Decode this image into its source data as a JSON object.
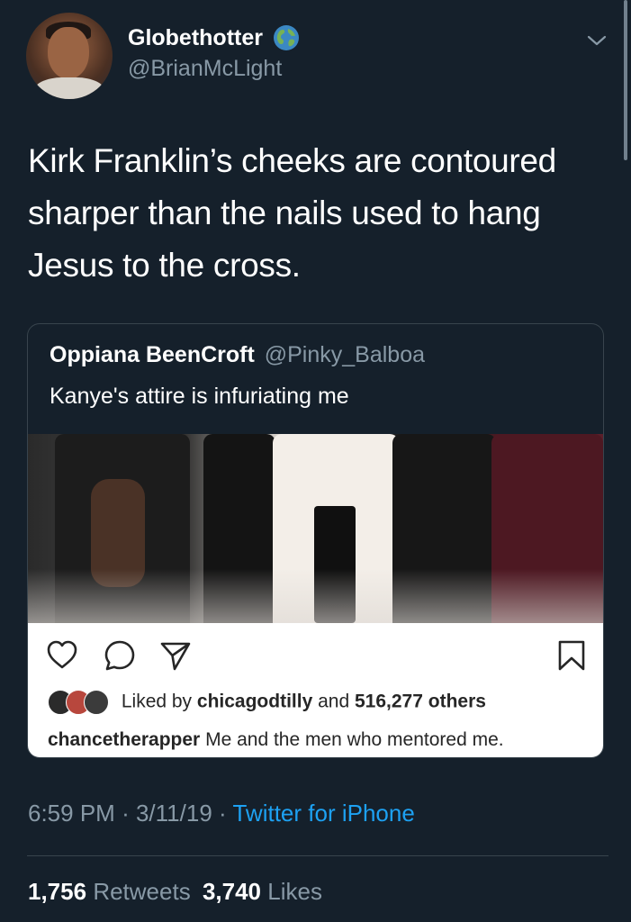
{
  "author": {
    "display_name": "Globethotter",
    "handle": "@BrianMcLight",
    "badge_icon": "globe-icon"
  },
  "tweet": {
    "text": "Kirk Franklin’s cheeks are contoured sharper than the nails used to hang Jesus to the cross."
  },
  "quoted": {
    "display_name": "Oppiana BeenCroft",
    "handle": "@Pinky_Balboa",
    "text": "Kanye's attire is infuriating me",
    "embedded_post": {
      "liked_by_prefix": "Liked by",
      "liked_by_user": "chicagodtilly",
      "liked_by_and": "and",
      "liked_by_count": "516,277 others",
      "caption_user": "chancetherapper",
      "caption_text": "Me and the men who mentored me.",
      "icons": [
        "heart-icon",
        "comment-icon",
        "share-icon",
        "bookmark-icon"
      ]
    }
  },
  "meta": {
    "time": "6:59 PM",
    "separator": "·",
    "date": "3/11/19",
    "source": "Twitter for iPhone"
  },
  "stats": {
    "retweets_count": "1,756",
    "retweets_label": "Retweets",
    "likes_count": "3,740",
    "likes_label": "Likes"
  },
  "colors": {
    "background": "#15202b",
    "secondary_text": "#8899a6",
    "link": "#1da1f2",
    "border": "#38444d"
  }
}
